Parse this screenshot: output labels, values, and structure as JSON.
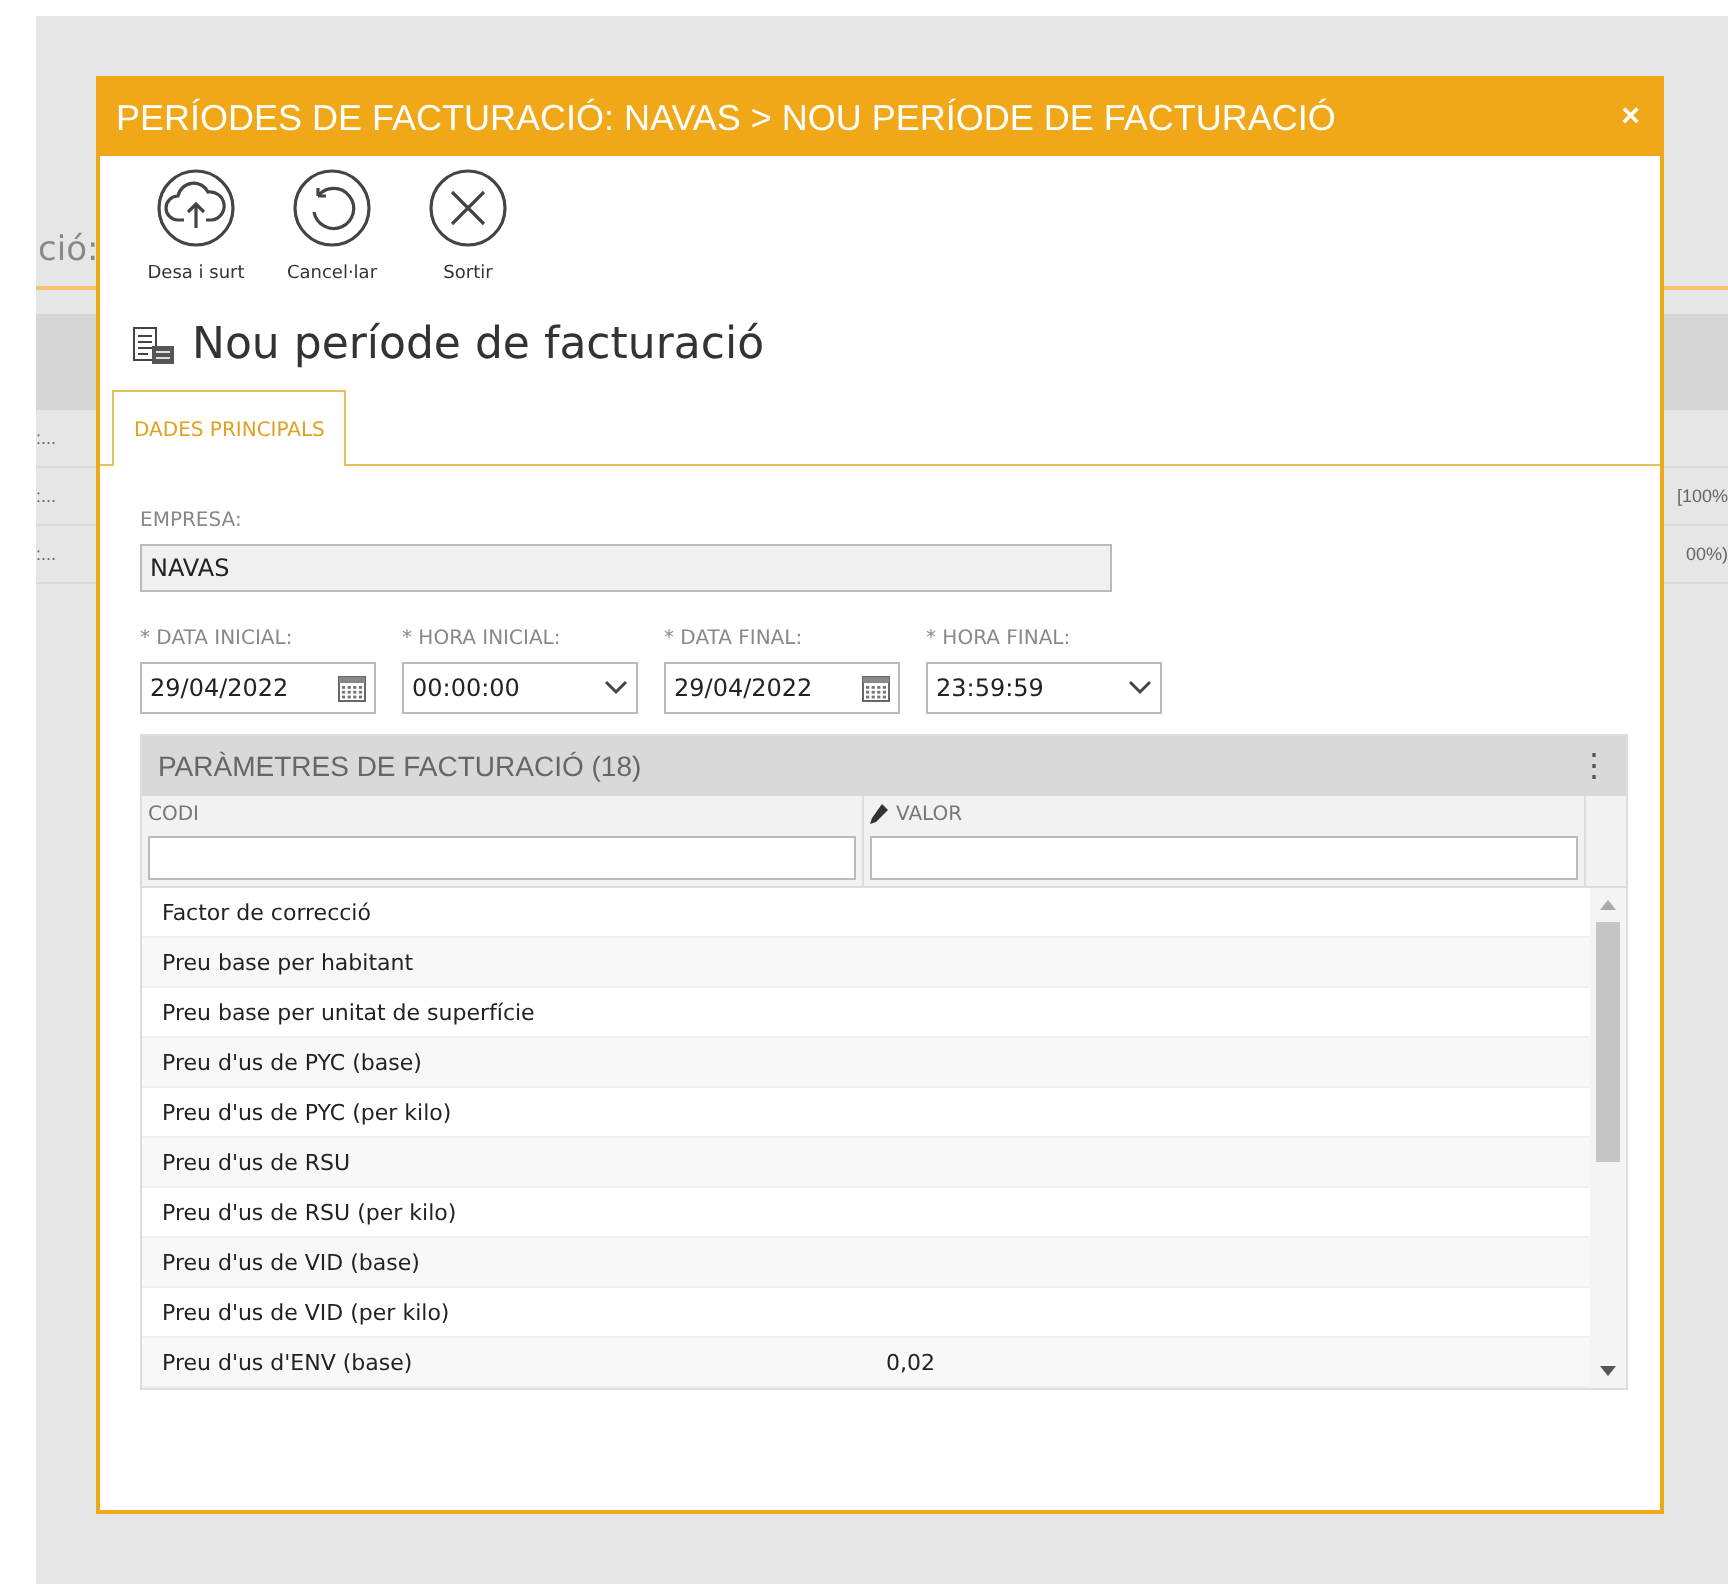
{
  "background": {
    "title": "ció:",
    "rows": [
      {
        "left": ":...",
        "right": ""
      },
      {
        "left": ":...",
        "right": "[100%"
      },
      {
        "left": ":...",
        "right": "00%)"
      }
    ]
  },
  "dialog": {
    "title": "PERÍODES DE FACTURACIÓ: NAVAS > NOU PERÍODE DE FACTURACIÓ",
    "close": "×"
  },
  "toolbar": [
    {
      "kind": "save",
      "label": "Desa i surt"
    },
    {
      "kind": "undo",
      "label": "Cancel·lar"
    },
    {
      "kind": "exit",
      "label": "Sortir"
    }
  ],
  "heading": "Nou període de facturació",
  "tabs": [
    {
      "label": "DADES PRINCIPALS",
      "selected": true
    }
  ],
  "empresa": {
    "label": "EMPRESA:",
    "value": "NAVAS"
  },
  "fields": [
    {
      "kind": "date",
      "label": "* DATA INICIAL:",
      "value": "29/04/2022"
    },
    {
      "kind": "time",
      "label": "* HORA INICIAL:",
      "value": "00:00:00"
    },
    {
      "kind": "date",
      "label": "* DATA FINAL:",
      "value": "29/04/2022"
    },
    {
      "kind": "time",
      "label": "* HORA FINAL:",
      "value": "23:59:59"
    }
  ],
  "grid": {
    "title": "PARÀMETRES DE FACTURACIÓ (18)",
    "menu": "⋮",
    "columns": [
      {
        "label": "CODI",
        "editable": false
      },
      {
        "label": "VALOR",
        "editable": true
      }
    ],
    "rows": [
      [
        "Factor de correcció",
        ""
      ],
      [
        "Preu base per habitant",
        ""
      ],
      [
        "Preu base per unitat de superfície",
        ""
      ],
      [
        "Preu d'us de PYC (base)",
        ""
      ],
      [
        "Preu d'us de PYC (per kilo)",
        ""
      ],
      [
        "Preu d'us de RSU",
        ""
      ],
      [
        "Preu d'us de RSU (per kilo)",
        ""
      ],
      [
        "Preu d'us de VID (base)",
        ""
      ],
      [
        "Preu d'us de VID (per kilo)",
        ""
      ],
      [
        "Preu d'us d'ENV (base)",
        "0,02"
      ]
    ]
  }
}
